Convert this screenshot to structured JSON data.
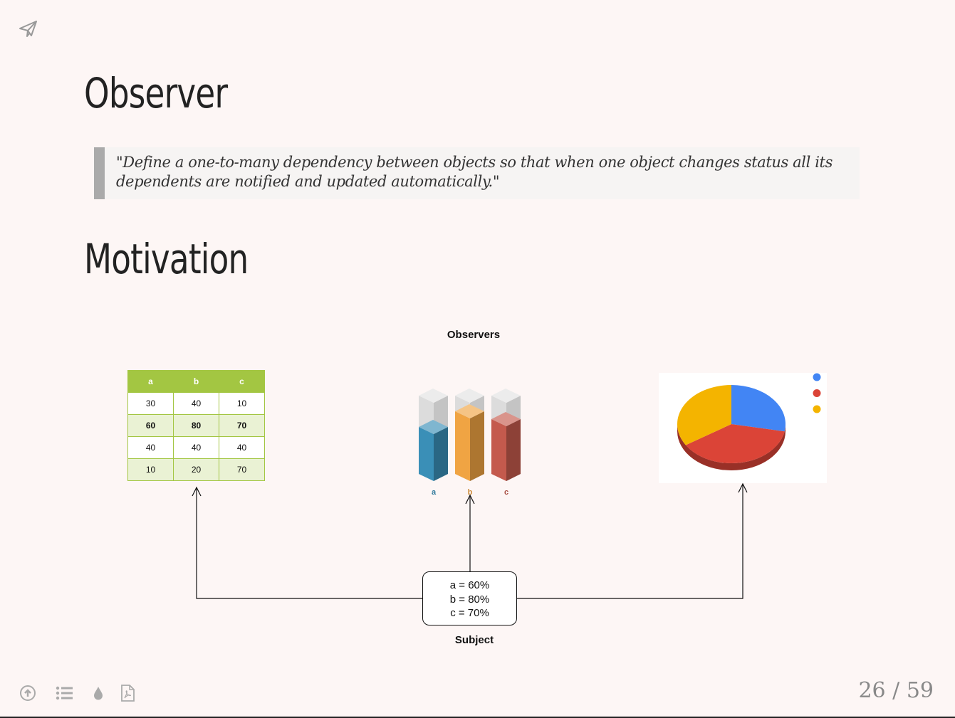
{
  "slide": {
    "title": "Observer",
    "quote": "\"Define a one-to-many dependency between objects so that when one object changes status all its dependents are notified and updated automatically.\"",
    "section_title": "Motivation"
  },
  "diagram": {
    "observers_label": "Observers",
    "table": {
      "headers": [
        "a",
        "b",
        "c"
      ],
      "rows": [
        [
          "30",
          "40",
          "10"
        ],
        [
          "60",
          "80",
          "70"
        ],
        [
          "40",
          "40",
          "40"
        ],
        [
          "10",
          "20",
          "70"
        ]
      ]
    },
    "bar_chart": {
      "labels": [
        "a",
        "b",
        "c"
      ],
      "fill": [
        0.6,
        0.8,
        0.7
      ],
      "colors": [
        "#3a8fb7",
        "#f0a443",
        "#c45a4d"
      ]
    },
    "pie_chart": {
      "values": [
        0.28,
        0.38,
        0.34
      ],
      "colors": [
        "#4285f4",
        "#db4437",
        "#f4b400"
      ]
    },
    "subject": {
      "line1": "a = 60%",
      "line2": "b = 80%",
      "line3": "c = 70%",
      "label": "Subject"
    }
  },
  "footer": {
    "page_number": "26 / 59",
    "icons": [
      "upload-icon",
      "list-icon",
      "drop-icon",
      "pdf-icon",
      "paper-plane-icon"
    ]
  }
}
